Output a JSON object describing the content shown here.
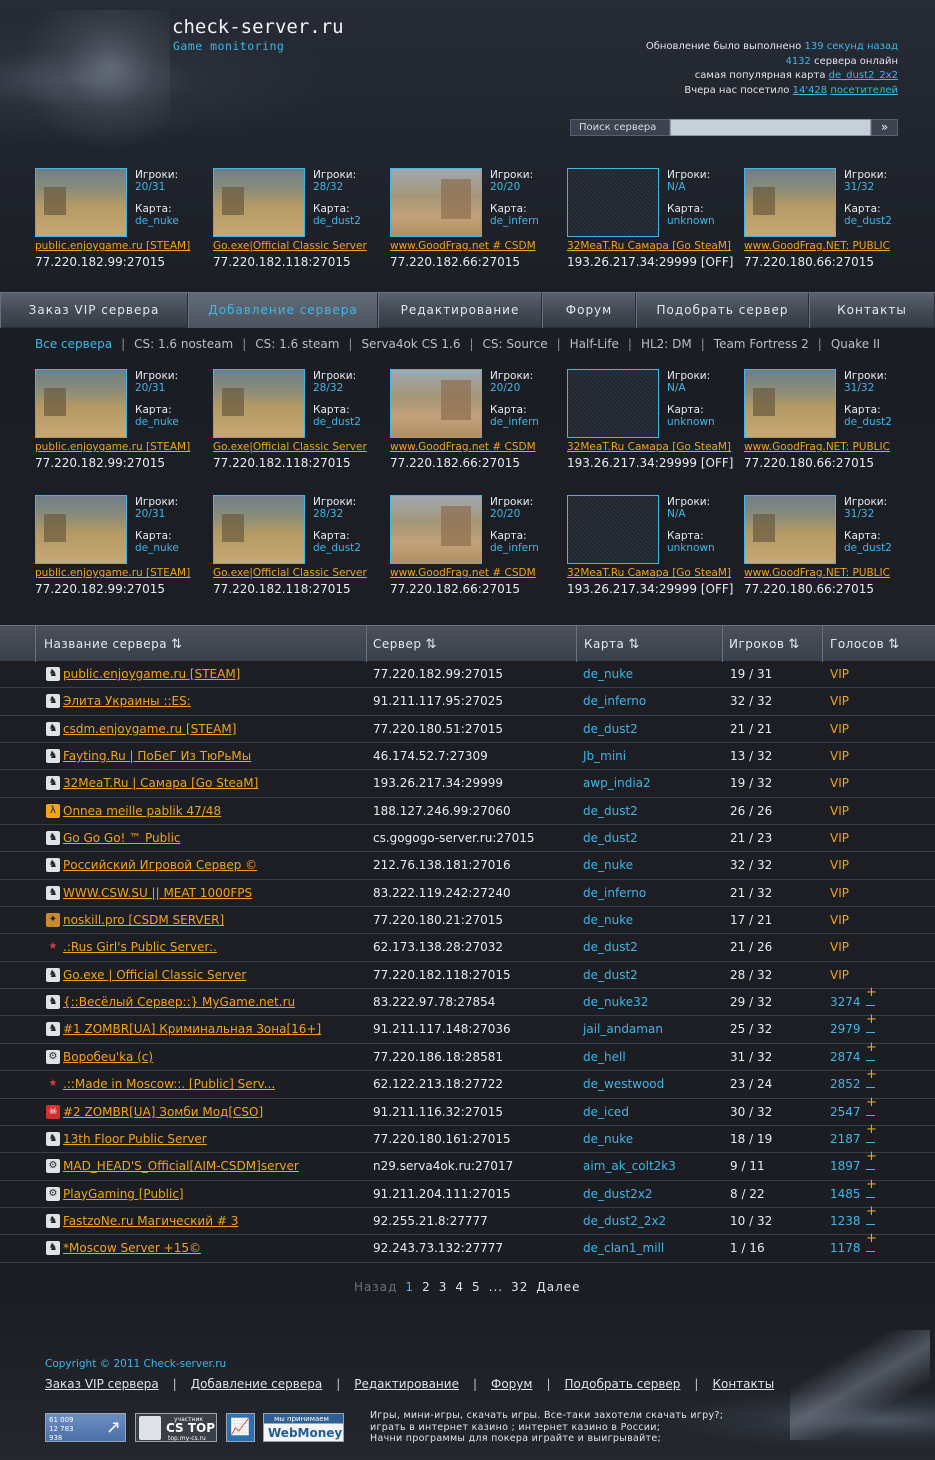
{
  "header": {
    "logo": "check-server.ru",
    "slogan": "Game monitoring",
    "stats": {
      "line1_prefix": "Обновление было выполнено ",
      "line1_link": "139 секунд назад",
      "line2_num": "4132",
      "line2_suffix": " сервера онлайн",
      "line3_prefix": "самая популярная карта ",
      "line3_link": "de_dust2_2x2",
      "line4_prefix": "Вчера нас посетило ",
      "line4_num": "14'428",
      "line4_link": "посетителей"
    },
    "search": {
      "label": "Поиск сервера",
      "value": "",
      "button": "»"
    }
  },
  "card_labels": {
    "players": "Игроки:",
    "map": "Карта:"
  },
  "cards": [
    {
      "players": "20/31",
      "map": "de_nuke",
      "name": "public.enjoygame.ru [STEAM]",
      "ip": "77.220.182.99:27015",
      "thumb": "map"
    },
    {
      "players": "28/32",
      "map": "de_dust2",
      "name": "Go.exe|Official Classic Server",
      "ip": "77.220.182.118:27015",
      "thumb": "map"
    },
    {
      "players": "20/20",
      "map": "de_infern",
      "name": "www.GoodFrag.net # CSDM",
      "ip": "77.220.182.66:27015",
      "thumb": "alt"
    },
    {
      "players": "N/A",
      "map": "unknown",
      "name": "32MeaT.Ru Самара [Go SteaM]",
      "ip": "193.26.217.34:29999 [OFF]",
      "thumb": "noise"
    },
    {
      "players": "31/32",
      "map": "de_dust2",
      "name": "www.GoodFrag.NET: PUBLIC",
      "ip": "77.220.180.66:27015",
      "thumb": "map"
    }
  ],
  "nav": [
    {
      "label": "Заказ VIP сервера",
      "active": false
    },
    {
      "label": "Добавление сервера",
      "active": true
    },
    {
      "label": "Редактирование",
      "active": false
    },
    {
      "label": "Форум",
      "active": false
    },
    {
      "label": "Подобрать сервер",
      "active": false
    },
    {
      "label": "Контакты",
      "active": false
    }
  ],
  "categories": [
    {
      "label": "Все сервера",
      "active": true
    },
    {
      "label": "CS: 1.6 nosteam",
      "active": false
    },
    {
      "label": "CS: 1.6 steam",
      "active": false
    },
    {
      "label": "Serva4ok CS 1.6",
      "active": false
    },
    {
      "label": "CS: Source",
      "active": false
    },
    {
      "label": "Half-Life",
      "active": false
    },
    {
      "label": "HL2: DM",
      "active": false
    },
    {
      "label": "Team Fortress 2",
      "active": false
    },
    {
      "label": "Quake II",
      "active": false
    }
  ],
  "table": {
    "headers": {
      "name": "Название сервера",
      "server": "Сервер",
      "map": "Карта",
      "players": "Игроков",
      "votes": "Голосов",
      "sort_icon": "⇅"
    },
    "rows": [
      {
        "icon": "cs",
        "name": "public.enjoygame.ru [STEAM]",
        "server": "77.220.182.99:27015",
        "map": "de_nuke",
        "players": "19 / 31",
        "votes": "VIP"
      },
      {
        "icon": "cs",
        "name": "Элита  Украины ::ES:",
        "server": "91.211.117.95:27025",
        "map": "de_inferno",
        "players": "32 / 32",
        "votes": "VIP"
      },
      {
        "icon": "cs",
        "name": "csdm.enjoygame.ru [STEAM]",
        "server": "77.220.180.51:27015",
        "map": "de_dust2",
        "players": "21 / 21",
        "votes": "VIP"
      },
      {
        "icon": "cs",
        "name": "Fayting.Ru | ПоБеГ Из ТюРьМы",
        "server": "46.174.52.7:27309",
        "map": "Jb_mini",
        "players": "13 / 32",
        "votes": "VIP"
      },
      {
        "icon": "cs",
        "name": "32MeaT.Ru | Самара [Go SteaM]",
        "server": "193.26.217.34:29999",
        "map": "awp_india2",
        "players": "19 / 32",
        "votes": "VIP"
      },
      {
        "icon": "hl",
        "name": "Onnea meille pablik 47/48",
        "server": "188.127.246.99:27060",
        "map": "de_dust2",
        "players": "26 / 26",
        "votes": "VIP"
      },
      {
        "icon": "cs",
        "name": "Go Go Go! ™ Public",
        "server": "cs.gogogo-server.ru:27015",
        "map": "de_dust2",
        "players": "21 / 23",
        "votes": "VIP"
      },
      {
        "icon": "cs",
        "name": "Российский Игровой Сервер ©",
        "server": "212.76.138.181:27016",
        "map": "de_nuke",
        "players": "32 / 32",
        "votes": "VIP"
      },
      {
        "icon": "cs",
        "name": "WWW.CSW.SU || MEAT 1000FPS",
        "server": "83.222.119.242:27240",
        "map": "de_inferno",
        "players": "21 / 32",
        "votes": "VIP"
      },
      {
        "icon": "tf",
        "name": "noskill.pro [CSDM SERVER]",
        "server": "77.220.180.21:27015",
        "map": "de_nuke",
        "players": "17 / 21",
        "votes": "VIP"
      },
      {
        "icon": "star",
        "name": ".:Rus Girl's Public Server:.",
        "server": "62.173.138.28:27032",
        "map": "de_dust2",
        "players": "21 / 26",
        "votes": "VIP"
      },
      {
        "icon": "cs",
        "name": "Go.exe | Official Classic Server",
        "server": "77.220.182.118:27015",
        "map": "de_dust2",
        "players": "28 / 32",
        "votes": "VIP"
      },
      {
        "icon": "cs",
        "name": "{::Весёлый Сервер::} MyGame.net.ru",
        "server": "83.222.97.78:27854",
        "map": "de_nuke32",
        "players": "29 / 32",
        "votes": "3274"
      },
      {
        "icon": "cs",
        "name": "#1 ZOMBR[UA] Криминальная Зона[16+]",
        "server": "91.211.117.148:27036",
        "map": "jail_andaman",
        "players": "25 / 32",
        "votes": "2979"
      },
      {
        "icon": "gear",
        "name": "Воробеu'ka (c)",
        "server": "77.220.186.18:28581",
        "map": "de_hell",
        "players": "31 / 32",
        "votes": "2874"
      },
      {
        "icon": "star",
        "name": ".::Made in Moscow::. [Public] Serv...",
        "server": "62.122.213.18:27722",
        "map": "de_westwood",
        "players": "23 / 24",
        "votes": "2852"
      },
      {
        "icon": "zombie",
        "name": "#2 ZOMBR[UA] Зомби Мод[CSO]",
        "server": "91.211.116.32:27015",
        "map": "de_iced",
        "players": "30 / 32",
        "votes": "2547"
      },
      {
        "icon": "cs",
        "name": "13th Floor Public Server",
        "server": "77.220.180.161:27015",
        "map": "de_nuke",
        "players": "18 / 19",
        "votes": "2187"
      },
      {
        "icon": "gear",
        "name": "MAD_HEAD'S_Official[AIM-CSDM]server",
        "server": "n29.serva4ok.ru:27017",
        "map": "aim_ak_colt2k3",
        "players": "9 / 11",
        "votes": "1897"
      },
      {
        "icon": "gear",
        "name": "PlayGaming [Public]",
        "server": "91.211.204.111:27015",
        "map": "de_dust2x2",
        "players": "8 / 22",
        "votes": "1485"
      },
      {
        "icon": "cs",
        "name": "FastzoNe.ru Магический # 3",
        "server": "92.255.21.8:27777",
        "map": "de_dust2_2x2",
        "players": "10 / 32",
        "votes": "1238"
      },
      {
        "icon": "cs",
        "name": "*Moscow Server +15©",
        "server": "92.243.73.132:27777",
        "map": "de_clan1_mill",
        "players": "1 / 16",
        "votes": "1178"
      }
    ],
    "plus_label": "+"
  },
  "pager": {
    "prev": "Назад",
    "pages": [
      "1",
      "2",
      "3",
      "4",
      "5"
    ],
    "ellipsis": "...",
    "last": "32",
    "next": "Далее"
  },
  "footer": {
    "copyright": "Copyright © 2011 Check-server.ru",
    "links": [
      "Заказ VIP сервера",
      "Добавление сервера",
      "Редактирование",
      "Форум",
      "Подобрать сервер",
      "Контакты"
    ],
    "badges": {
      "counter": [
        "61 009",
        "12 783",
        "938"
      ],
      "cstop_top": "участник",
      "cstop_title": "CS TOP",
      "cstop_sub": "top.my-cs.ru",
      "webmoney_top": "мы принимаем",
      "webmoney_title": "WebMoney"
    },
    "text": [
      "Игры, мини-игры, скачать игры. Все-таки захотели скачать игру?;",
      "играть в интернет казино ; интернет казино в России;",
      "Начни программы для покера играйте и выигрывайте;"
    ]
  },
  "colors": {
    "accent": "#3fb6e6",
    "link": "#f0a418",
    "text": "#e8ecf0",
    "background": "#1c1e24"
  }
}
